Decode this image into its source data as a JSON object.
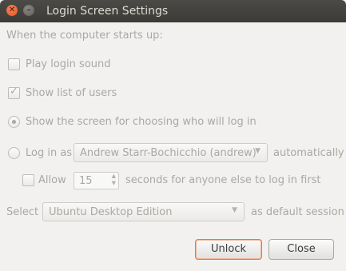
{
  "window": {
    "title": "Login Screen Settings"
  },
  "section_label": "When the computer starts up:",
  "options": {
    "play_login_sound": {
      "label": "Play login sound",
      "checked": false
    },
    "show_list_of_users": {
      "label": "Show list of users",
      "checked": true
    },
    "show_choose_screen": {
      "label": "Show the screen for choosing who will log in",
      "selected": true
    },
    "login_as": {
      "label": "Log in as",
      "user": "Andrew Starr-Bochicchio (andrew)",
      "suffix": "automatically",
      "selected": false
    },
    "allow": {
      "label": "Allow",
      "seconds": "15",
      "suffix": "seconds for anyone else to log in first",
      "checked": false
    }
  },
  "session": {
    "prefix": "Select",
    "value": "Ubuntu Desktop Edition",
    "suffix": "as default session"
  },
  "buttons": {
    "unlock": "Unlock",
    "close": "Close"
  },
  "colors": {
    "titlebar": "#3c3b37",
    "focus_border": "#e07a50",
    "disabled_text": "#a9a8a4"
  }
}
